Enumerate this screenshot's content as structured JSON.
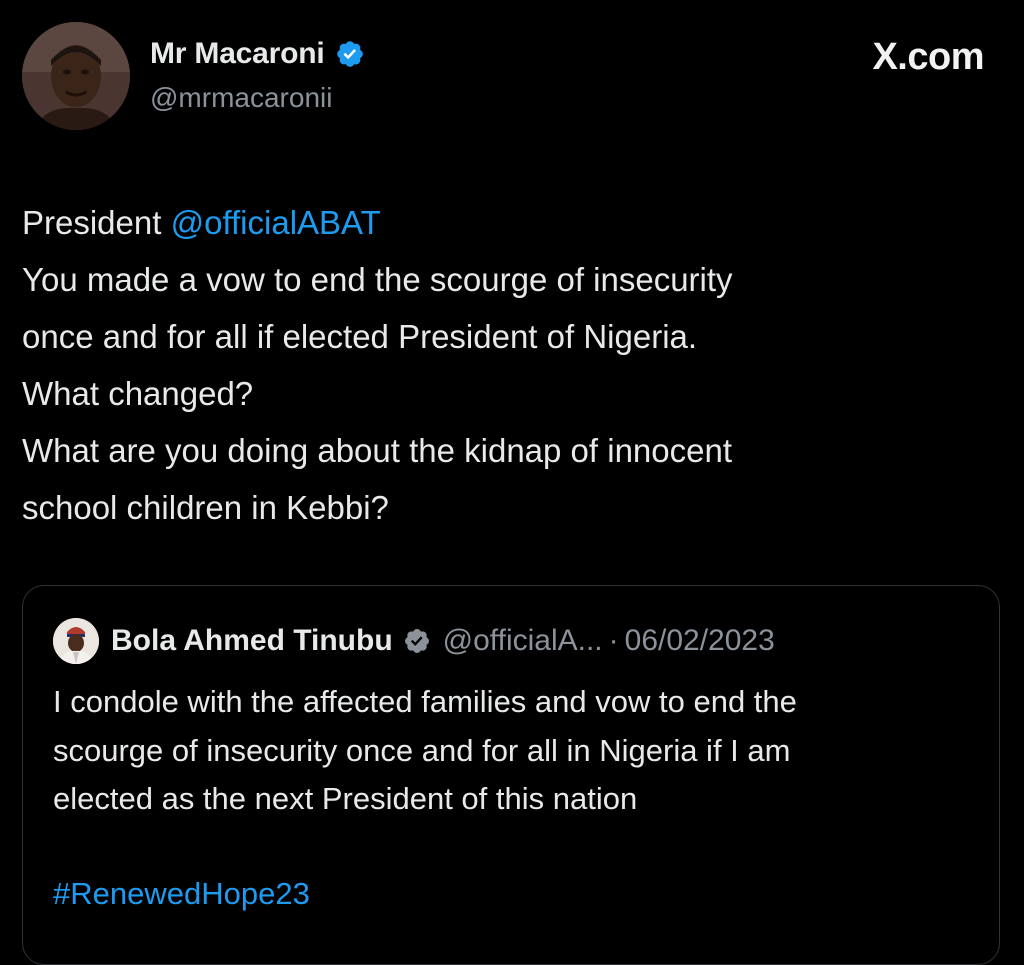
{
  "author": {
    "display_name": "Mr Macaroni",
    "handle": "@mrmacaronii",
    "avatar_icon": "profile-photo-icon",
    "verified_icon": "verified-badge-icon"
  },
  "brand": {
    "label": "X.com"
  },
  "tweet": {
    "prefix": "President ",
    "mention": "@officialABAT",
    "lines": [
      "You made a vow to end the scourge of insecurity",
      "once and for all if elected President of Nigeria.",
      "What changed?",
      "What are you doing about the kidnap of innocent",
      "school children in Kebbi?"
    ]
  },
  "quoted_tweet": {
    "display_name": "Bola Ahmed Tinubu",
    "handle": "@officialA...",
    "separator": "·",
    "date": "06/02/2023",
    "lines": [
      "I condole with the affected families and vow to end the",
      "scourge of insecurity once and for all in Nigeria if I am",
      "elected as the next President of this nation"
    ],
    "hashtag": "#RenewedHope23"
  },
  "colors": {
    "background": "#000000",
    "text": "#e7e9ea",
    "secondary_text": "#8b9299",
    "link": "#1d9bf0",
    "verified": "#1d9bf0",
    "card_border": "#2f3336"
  }
}
